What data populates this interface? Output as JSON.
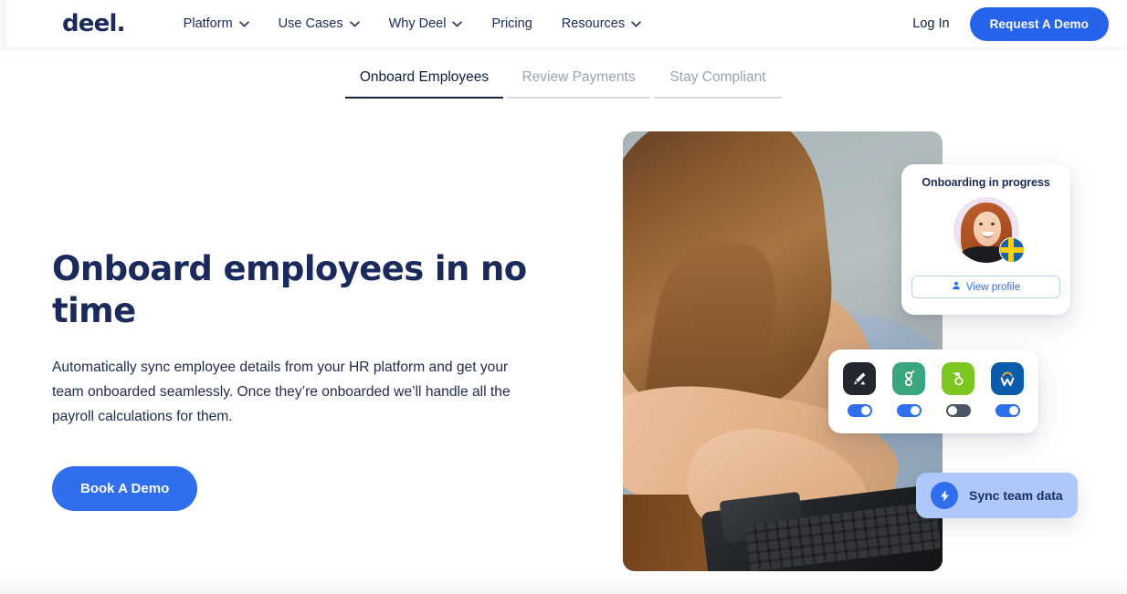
{
  "nav": {
    "brand": "deel.",
    "links": [
      {
        "label": "Platform",
        "icon": "chevron-down-icon",
        "has_caret": true
      },
      {
        "label": "Use Cases",
        "icon": "chevron-down-icon",
        "has_caret": true
      },
      {
        "label": "Why Deel",
        "icon": "chevron-down-icon",
        "has_caret": true
      },
      {
        "label": "Pricing",
        "icon": "",
        "has_caret": false
      },
      {
        "label": "Resources",
        "icon": "chevron-down-icon",
        "has_caret": true
      }
    ],
    "login_label": "Log In",
    "demo_label": "Request A Demo"
  },
  "tabs": [
    {
      "label": "Onboard Employees",
      "active": true
    },
    {
      "label": "Review Payments",
      "active": false
    },
    {
      "label": "Stay Compliant",
      "active": false
    }
  ],
  "hero": {
    "title": "Onboard employees in no time",
    "description": "Automatically sync employee details from your HR platform and get your team onboarded seamlessly. Once they’re onboarded we’ll handle all the payroll calculations for them.",
    "cta_label": "Book A Demo",
    "image_alt": "woman-typing-on-laptop-photo"
  },
  "onboarding_card": {
    "title": "Onboarding in progress",
    "avatar_name": "employee-avatar",
    "flag": "sweden-flag-badge",
    "button_label": "View profile",
    "button_icon": "person-icon"
  },
  "integrations_card": {
    "items": [
      {
        "name": "ashby",
        "icon": "pen-icon",
        "bg": "#23272f",
        "fg": "#ffffff",
        "glyph": "✎",
        "toggle_on": true
      },
      {
        "name": "greenhouse",
        "icon": "letter-g-icon",
        "bg": "#3aa67e",
        "fg": "#ffffff",
        "glyph": "g",
        "toggle_on": true
      },
      {
        "name": "bamboohr",
        "icon": "letter-b-icon",
        "bg": "#7dc520",
        "fg": "#ffffff",
        "glyph": "b",
        "toggle_on": false
      },
      {
        "name": "workday",
        "icon": "letter-w-icon",
        "bg": "#0b5cab",
        "fg": "#ffffff",
        "glyph": "W",
        "toggle_on": true
      }
    ]
  },
  "sync_pill": {
    "label": "Sync team data",
    "icon": "lightning-bolt-icon",
    "bg": "#aec8fb",
    "icon_bg": "#2f6fed"
  },
  "colors": {
    "brand_navy": "#1b2a5c",
    "accent_blue": "#2f6fed",
    "cta_blue": "#2563eb",
    "muted_text": "#9aa2b1",
    "body_text": "#1e2b4d",
    "toggle_off": "#4b5563"
  }
}
